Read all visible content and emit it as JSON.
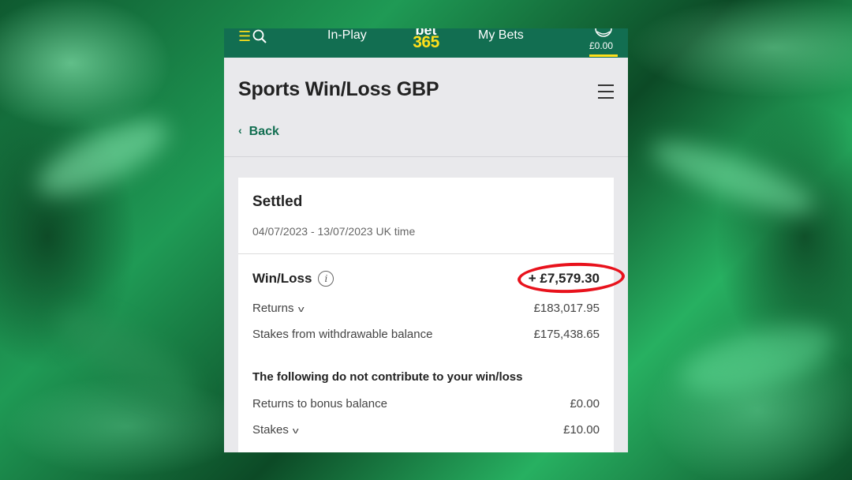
{
  "topbar": {
    "menu_icon": "menu-icon",
    "search_icon": "search-icon",
    "inplay": "In-Play",
    "logo_top": "bet",
    "logo_bottom": "365",
    "mybets": "My Bets",
    "account_icon": "account-icon",
    "balance": "£0.00"
  },
  "header": {
    "title": "Sports Win/Loss GBP",
    "back": "Back",
    "menu_icon": "hamburger-icon"
  },
  "summary": {
    "status": "Settled",
    "date_range": "04/07/2023 - 13/07/2023 UK time",
    "winloss_label": "Win/Loss",
    "winloss_value": "+ £7,579.30",
    "returns_label": "Returns",
    "returns_value": "£183,017.95",
    "stakes_withdrawable_label": "Stakes from withdrawable balance",
    "stakes_withdrawable_value": "£175,438.65",
    "note": "The following do not contribute to your win/loss",
    "bonus_returns_label": "Returns to bonus balance",
    "bonus_returns_value": "£0.00",
    "stakes_label": "Stakes",
    "stakes_value": "£10.00"
  },
  "colors": {
    "brand_green": "#126e51",
    "brand_yellow": "#ffdf1b",
    "highlight_red": "#e8121c"
  }
}
